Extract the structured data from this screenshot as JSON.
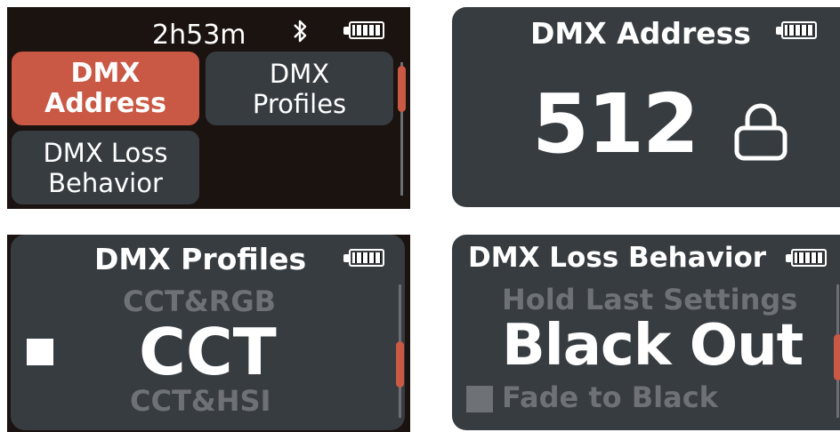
{
  "menu": {
    "time": "2h53m",
    "tiles": [
      {
        "line1": "DMX",
        "line2": "Address"
      },
      {
        "line1": "DMX",
        "line2": "Profiles"
      },
      {
        "line1": "DMX Loss",
        "line2": "Behavior"
      }
    ]
  },
  "address": {
    "title": "DMX Address",
    "value": "512"
  },
  "profiles": {
    "title": "DMX Profiles",
    "prev": "CCT&RGB",
    "current": "CCT",
    "next": "CCT&HSI"
  },
  "loss": {
    "title": "DMX Loss Behavior",
    "prev": "Hold Last Settings",
    "current": "Black Out",
    "next": "Fade to Black"
  },
  "colors": {
    "accent": "#c95844",
    "panel": "#373c41",
    "background": "#1b1310",
    "dim_text": "#6e7277"
  }
}
